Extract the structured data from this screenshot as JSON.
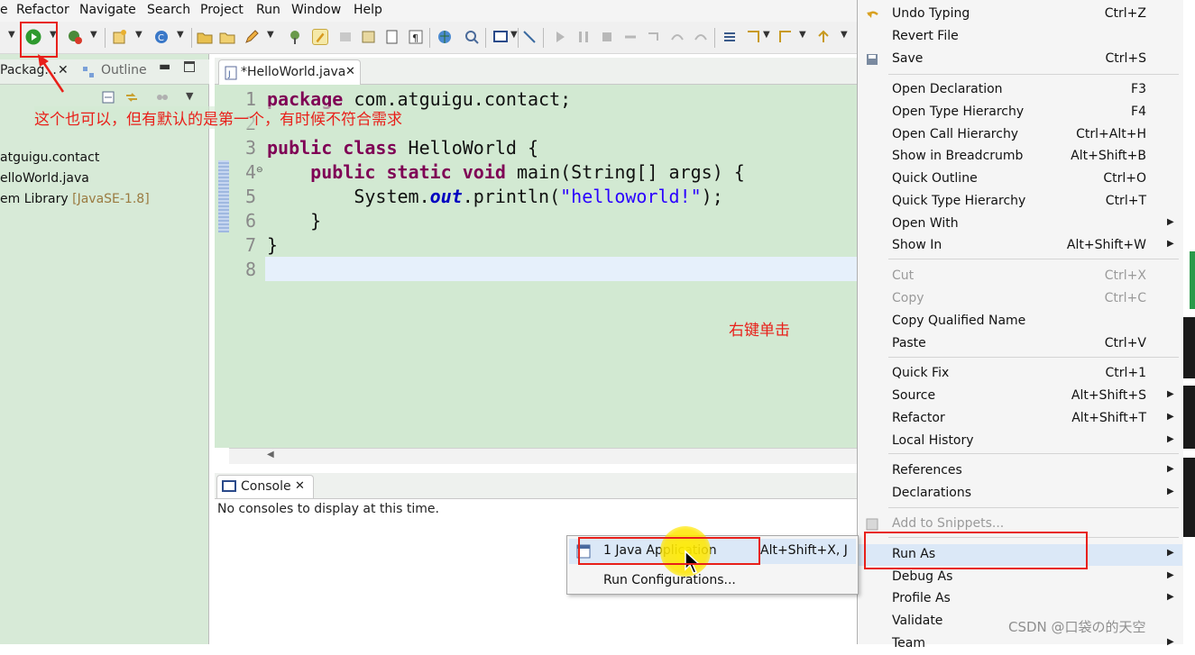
{
  "menubar": {
    "items": [
      "e",
      "Refactor",
      "Navigate",
      "Search",
      "Project",
      "Run",
      "Window",
      "Help"
    ]
  },
  "left_panel": {
    "tab_package": "Packag...",
    "tab_outline": "Outline",
    "tree": [
      "atguigu.contact",
      "elloWorld.java",
      "em Library",
      "[JavaSE-1.8]"
    ]
  },
  "editor": {
    "tab_title": "*HelloWorld.java",
    "line_numbers": [
      "1",
      "2",
      "3",
      "4",
      "5",
      "6",
      "7",
      "8"
    ]
  },
  "console": {
    "tab_title": "Console",
    "message": "No consoles to display at this time."
  },
  "run_as_submenu": {
    "items": [
      {
        "label": "1 Java Application",
        "shortcut": "Alt+Shift+X, J"
      },
      {
        "label": "Run Configurations...",
        "shortcut": ""
      }
    ]
  },
  "context_menu": {
    "items": [
      {
        "label": "Undo Typing",
        "shortcut": "Ctrl+Z",
        "arrow": false,
        "disabled": false
      },
      {
        "label": "Revert File",
        "shortcut": "",
        "arrow": false,
        "disabled": false
      },
      {
        "label": "Save",
        "shortcut": "Ctrl+S",
        "arrow": false,
        "disabled": false
      },
      {
        "label": "Open Declaration",
        "shortcut": "F3",
        "arrow": false,
        "disabled": false
      },
      {
        "label": "Open Type Hierarchy",
        "shortcut": "F4",
        "arrow": false,
        "disabled": false
      },
      {
        "label": "Open Call Hierarchy",
        "shortcut": "Ctrl+Alt+H",
        "arrow": false,
        "disabled": false
      },
      {
        "label": "Show in Breadcrumb",
        "shortcut": "Alt+Shift+B",
        "arrow": false,
        "disabled": false
      },
      {
        "label": "Quick Outline",
        "shortcut": "Ctrl+O",
        "arrow": false,
        "disabled": false
      },
      {
        "label": "Quick Type Hierarchy",
        "shortcut": "Ctrl+T",
        "arrow": false,
        "disabled": false
      },
      {
        "label": "Open With",
        "shortcut": "",
        "arrow": true,
        "disabled": false
      },
      {
        "label": "Show In",
        "shortcut": "Alt+Shift+W",
        "arrow": true,
        "disabled": false
      },
      {
        "label": "Cut",
        "shortcut": "Ctrl+X",
        "arrow": false,
        "disabled": true
      },
      {
        "label": "Copy",
        "shortcut": "Ctrl+C",
        "arrow": false,
        "disabled": true
      },
      {
        "label": "Copy Qualified Name",
        "shortcut": "",
        "arrow": false,
        "disabled": false
      },
      {
        "label": "Paste",
        "shortcut": "Ctrl+V",
        "arrow": false,
        "disabled": false
      },
      {
        "label": "Quick Fix",
        "shortcut": "Ctrl+1",
        "arrow": false,
        "disabled": false
      },
      {
        "label": "Source",
        "shortcut": "Alt+Shift+S",
        "arrow": true,
        "disabled": false
      },
      {
        "label": "Refactor",
        "shortcut": "Alt+Shift+T",
        "arrow": true,
        "disabled": false
      },
      {
        "label": "Local History",
        "shortcut": "",
        "arrow": true,
        "disabled": false
      },
      {
        "label": "References",
        "shortcut": "",
        "arrow": true,
        "disabled": false
      },
      {
        "label": "Declarations",
        "shortcut": "",
        "arrow": true,
        "disabled": false
      },
      {
        "label": "Add to Snippets...",
        "shortcut": "",
        "arrow": false,
        "disabled": true
      },
      {
        "label": "Run As",
        "shortcut": "",
        "arrow": true,
        "disabled": false
      },
      {
        "label": "Debug As",
        "shortcut": "",
        "arrow": true,
        "disabled": false
      },
      {
        "label": "Profile As",
        "shortcut": "",
        "arrow": true,
        "disabled": false
      },
      {
        "label": "Validate",
        "shortcut": "",
        "arrow": false,
        "disabled": false
      },
      {
        "label": "Team",
        "shortcut": "",
        "arrow": true,
        "disabled": false
      }
    ]
  },
  "annotations": {
    "toolbar_note": "这个也可以，但有默认的是第一个，有时候不符合需求",
    "right_click_note": "右键单击",
    "watermark": "CSDN @口袋の的天空"
  },
  "colors": {
    "annotation_red": "#e8201a",
    "editor_bg": "#d2e9d2",
    "keyword": "#7f0055",
    "string": "#2a00ff",
    "static_field": "#0000c0"
  },
  "icons": [
    "run-icon",
    "debug-icon",
    "new-icon",
    "package-explorer-icon",
    "outline-icon",
    "java-file-icon",
    "console-icon",
    "save-icon",
    "undo-icon",
    "java-app-icon"
  ]
}
